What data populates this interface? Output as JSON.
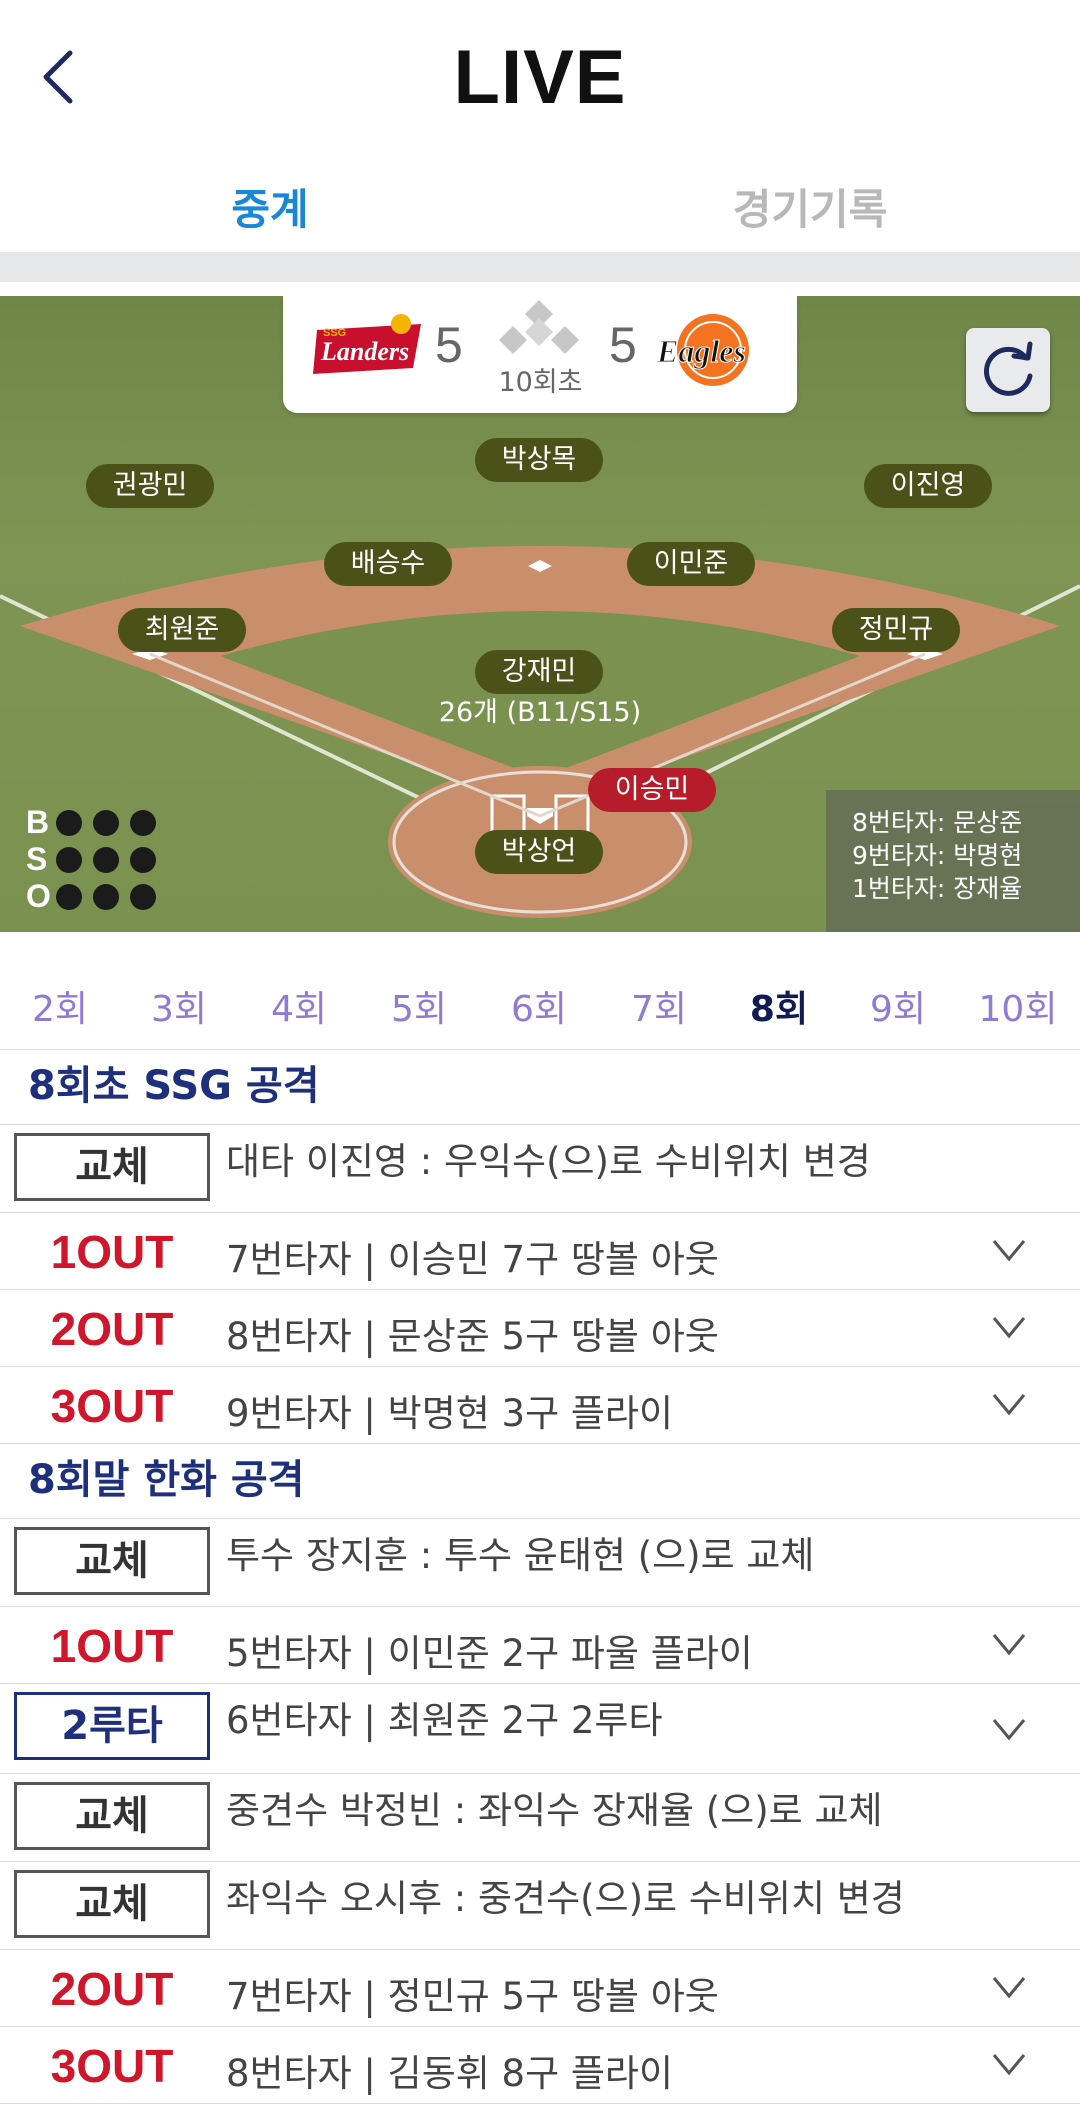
{
  "header": {
    "title": "LIVE",
    "back_icon": "chevron-left-icon"
  },
  "tabs": [
    {
      "label": "중계",
      "active": true
    },
    {
      "label": "경기기록",
      "active": false
    }
  ],
  "scoreboard": {
    "away": {
      "team": "SSG Landers",
      "logo_text": "Landers",
      "logo_small": "SSG",
      "score": "5"
    },
    "home": {
      "team": "Hanwha Eagles",
      "logo_text": "Eagles",
      "score": "5"
    },
    "inning": "10회초",
    "refresh_icon": "refresh-icon"
  },
  "field": {
    "players": {
      "lf": "권광민",
      "cf": "박상목",
      "rf": "이진영",
      "ss": "배승수",
      "second": "이민준",
      "third": "최원준",
      "first": "정민규",
      "pitcher": "강재민",
      "batter": "이승민",
      "catcher": "박상언"
    },
    "pitch_count": "26개 (B11/S15)",
    "bso": {
      "b": "B",
      "s": "S",
      "o": "O"
    },
    "next_batters": [
      "8번타자: 문상준",
      "9번타자: 박명현",
      "1번타자: 장재율"
    ]
  },
  "innings": [
    "2회",
    "3회",
    "4회",
    "5회",
    "6회",
    "7회",
    "8회",
    "9회",
    "10회"
  ],
  "active_inning": "8회",
  "log": {
    "top": {
      "title": "8회초 SSG 공격",
      "rows": [
        {
          "badge": "교체",
          "text": "대타 이진영 : 우익수(으)로 수비위치 변경"
        },
        {
          "badge": "1OUT",
          "text": "7번타자 | 이승민 7구 땅볼 아웃"
        },
        {
          "badge": "2OUT",
          "text": "8번타자 | 문상준 5구 땅볼 아웃"
        },
        {
          "badge": "3OUT",
          "text": "9번타자 | 박명현 3구 플라이"
        }
      ]
    },
    "bottom": {
      "title": "8회말 한화 공격",
      "rows": [
        {
          "badge": "교체",
          "text": "투수 장지훈 : 투수 윤태현 (으)로 교체"
        },
        {
          "badge": "1OUT",
          "text": "5번타자 | 이민준 2구 파울 플라이"
        },
        {
          "badge": "2루타",
          "text": "6번타자 | 최원준 2구 2루타"
        },
        {
          "badge": "교체",
          "text": "중견수 박정빈 : 좌익수 장재율 (으)로 교체"
        },
        {
          "badge": "교체",
          "text": "좌익수 오시후 : 중견수(으)로 수비위치 변경"
        },
        {
          "badge": "2OUT",
          "text": "7번타자 | 정민규 5구 땅볼 아웃"
        },
        {
          "badge": "3OUT",
          "text": "8번타자 | 김동휘 8구 플라이"
        }
      ]
    }
  },
  "colors": {
    "accent": "#1a86d8",
    "out": "#d0162b",
    "navy": "#1e2f7c",
    "inning_tab": "#8f7bd4"
  }
}
